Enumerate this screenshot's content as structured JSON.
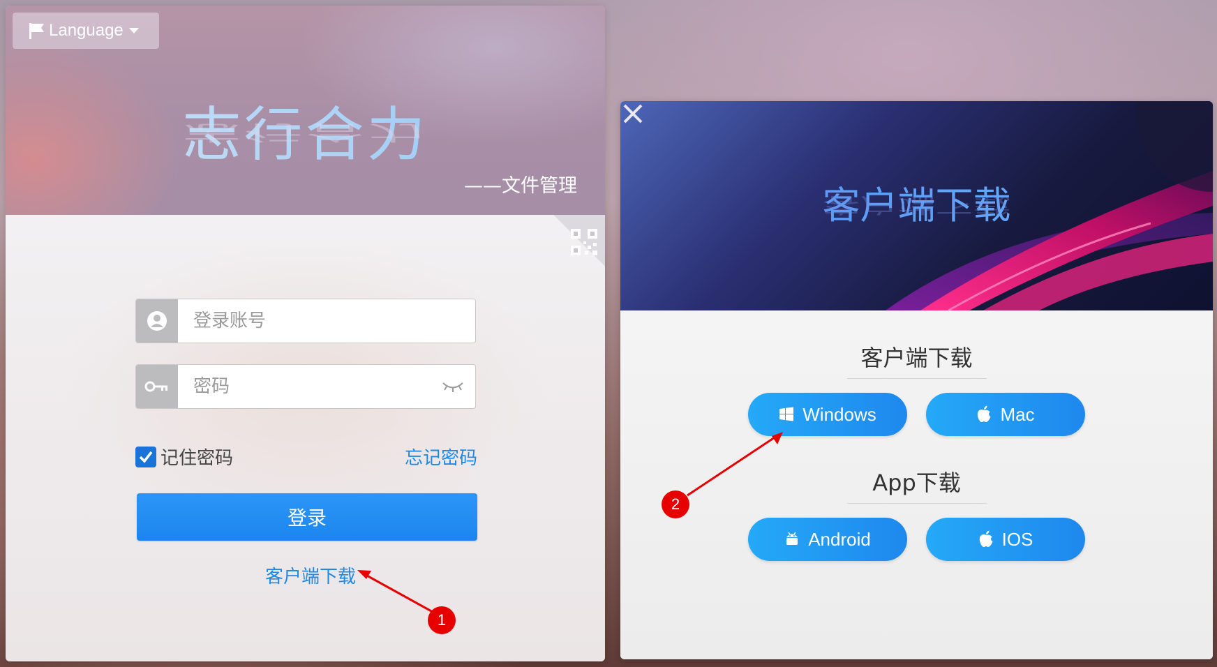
{
  "language_menu": {
    "label": "Language"
  },
  "brand": {
    "title": "志行合力",
    "subtitle": "——文件管理"
  },
  "login_form": {
    "account_placeholder": "登录账号",
    "password_placeholder": "密码",
    "remember_label": "记住密码",
    "remember_checked": true,
    "forgot_label": "忘记密码",
    "submit_label": "登录",
    "client_download_link": "客户端下载"
  },
  "download_dialog": {
    "banner_title": "客户端下载",
    "client_section": {
      "title": "客户端下载",
      "buttons": [
        {
          "label": "Windows",
          "icon": "windows-icon"
        },
        {
          "label": "Mac",
          "icon": "apple-icon"
        }
      ]
    },
    "app_section": {
      "title": "App下载",
      "buttons": [
        {
          "label": "Android",
          "icon": "android-icon"
        },
        {
          "label": "IOS",
          "icon": "apple-icon"
        }
      ]
    }
  },
  "annotations": {
    "marker_1": "1",
    "marker_2": "2"
  },
  "colors": {
    "primary_blue": "#1e88e5",
    "marker_red": "#e60000"
  }
}
